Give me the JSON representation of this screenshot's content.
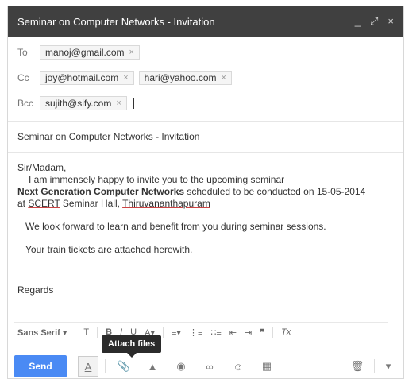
{
  "window": {
    "title": "Seminar on Computer Networks - Invitation",
    "controls": {
      "minimize": "_",
      "popout": "⤢",
      "close": "×"
    }
  },
  "recipients": {
    "to_label": "To",
    "cc_label": "Cc",
    "bcc_label": "Bcc",
    "to": [
      "manoj@gmail.com"
    ],
    "cc": [
      "joy@hotmail.com",
      "hari@yahoo.com"
    ],
    "bcc": [
      "sujith@sify.com"
    ],
    "chip_remove": "×"
  },
  "subject": "Seminar on Computer Networks - Invitation",
  "body": {
    "greeting": "Sir/Madam,",
    "line1": "I am immensely happy to invite you to the upcoming seminar",
    "event_name": "Next Generation Computer Networks",
    "line2_rest": " scheduled to be conducted on 15-05-2014",
    "at": "at ",
    "venue_org": "SCERT",
    "venue_mid": " Seminar Hall, ",
    "venue_city": "Thiruvananthapuram",
    "para2": "We look forward to learn and benefit from you during seminar sessions.",
    "para3": "Your train tickets are attached herewith.",
    "closing": "Regards"
  },
  "format_bar": {
    "font": "Sans Serif",
    "font_arrow": "▾",
    "size_icon": "T",
    "bold": "B",
    "italic": "I",
    "underline": "U",
    "text_color": "A",
    "text_color_arrow": "▾",
    "align": "≡",
    "align_arrow": "▾",
    "numbered_list": "⋮≡",
    "bulleted_list": "∷≡",
    "indent_less": "⇤",
    "indent_more": "⇥",
    "quote": "❞",
    "clear_format": "Tx"
  },
  "tooltip": "Attach files",
  "actions": {
    "send": "Send",
    "formatting": "A",
    "attach": "📎",
    "drive": "▲",
    "photo": "◉",
    "link": "∞",
    "emoji": "☺",
    "invite": "▦",
    "discard": "🗑",
    "more": "▾"
  }
}
